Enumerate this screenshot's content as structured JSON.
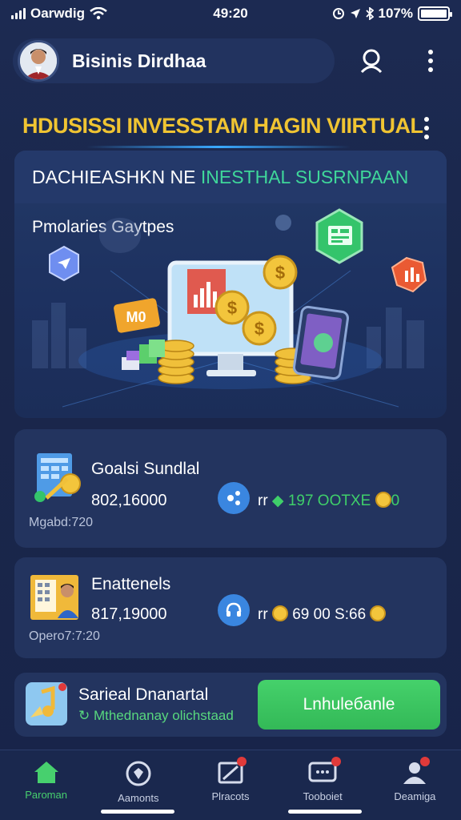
{
  "status_bar": {
    "carrier": "Oarwdig",
    "time": "49:20",
    "battery": "107%"
  },
  "header": {
    "name": "Bisinis Dirdhaa"
  },
  "banner": {
    "title": "HDUSISSI INVESSTAM HAGIN VIIRTUAL"
  },
  "hero": {
    "subtitle_a": "DACHIEASHKN NE ",
    "subtitle_b": "INESTHAL SUSRNPAAN",
    "caption": "Pmolaries Gaytpes"
  },
  "cards": [
    {
      "title": "Goalsi Sundlal",
      "amount": "802,16000",
      "footer": "Mgabd:720",
      "rate": "197 OOTXE"
    },
    {
      "title": "Enattenels",
      "amount": "817,19000",
      "footer": "Opero7:7:20",
      "rate": "69 00 S:66"
    }
  ],
  "action": {
    "title": "Sarieal Dnanartal",
    "subtitle": "Mthednanay olichstaad",
    "button": "Lnhuleбanle"
  },
  "nav": {
    "items": [
      {
        "label": "Paroman",
        "icon": "home-icon"
      },
      {
        "label": "Aamonts",
        "icon": "compass-icon"
      },
      {
        "label": "Plracots",
        "icon": "chart-icon"
      },
      {
        "label": "Tooboiet",
        "icon": "chat-icon"
      },
      {
        "label": "Deamiga",
        "icon": "profile-icon"
      }
    ]
  },
  "colors": {
    "accent_green": "#45d16b",
    "title_gold": "#f0c432",
    "background": "#1c2a52"
  }
}
